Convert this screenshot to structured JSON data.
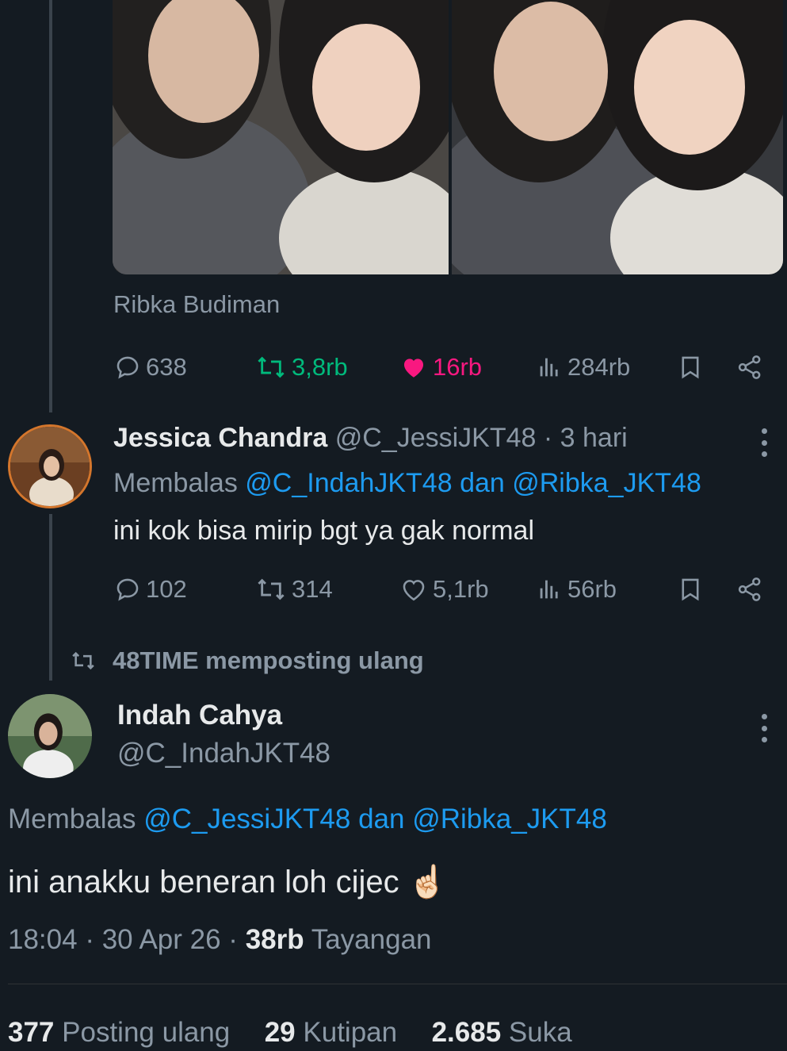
{
  "post1": {
    "caption": "Ribka Budiman",
    "replies": "638",
    "reposts": "3,8rb",
    "likes": "16rb",
    "views": "284rb",
    "colors": {
      "repost_active": "#00ba7c",
      "like_active": "#f91880"
    }
  },
  "reply": {
    "display_name": "Jessica Chandra",
    "handle": "@C_JessiJKT48",
    "separator": "·",
    "time": "3 hari",
    "replying_prefix": "Membalas",
    "replying_targets": "@C_IndahJKT48 dan @Ribka_JKT48",
    "text": "ini kok bisa mirip bgt ya gak normal",
    "replies": "102",
    "reposts": "314",
    "likes": "5,1rb",
    "views": "56rb"
  },
  "repost_banner": {
    "text": "48TIME memposting ulang"
  },
  "main": {
    "display_name": "Indah Cahya",
    "handle": "@C_IndahJKT48",
    "replying_prefix": "Membalas",
    "replying_targets": "@C_JessiJKT48 dan @Ribka_JKT48",
    "text": "ini anakku beneran loh cijec ☝🏻",
    "time": "18:04",
    "date": "30 Apr 26",
    "views_count": "38rb",
    "views_label": "Tayangan",
    "stats": {
      "reposts_count": "377",
      "reposts_label": "Posting ulang",
      "quotes_count": "29",
      "quotes_label": "Kutipan",
      "likes_count": "2.685",
      "likes_label": "Suka"
    }
  },
  "icons": {
    "reply": "reply-bubble-icon",
    "repost": "repost-icon",
    "like": "heart-icon",
    "views": "views-bars-icon",
    "bookmark": "bookmark-icon",
    "share": "share-icon",
    "more": "more-vertical-icon"
  }
}
